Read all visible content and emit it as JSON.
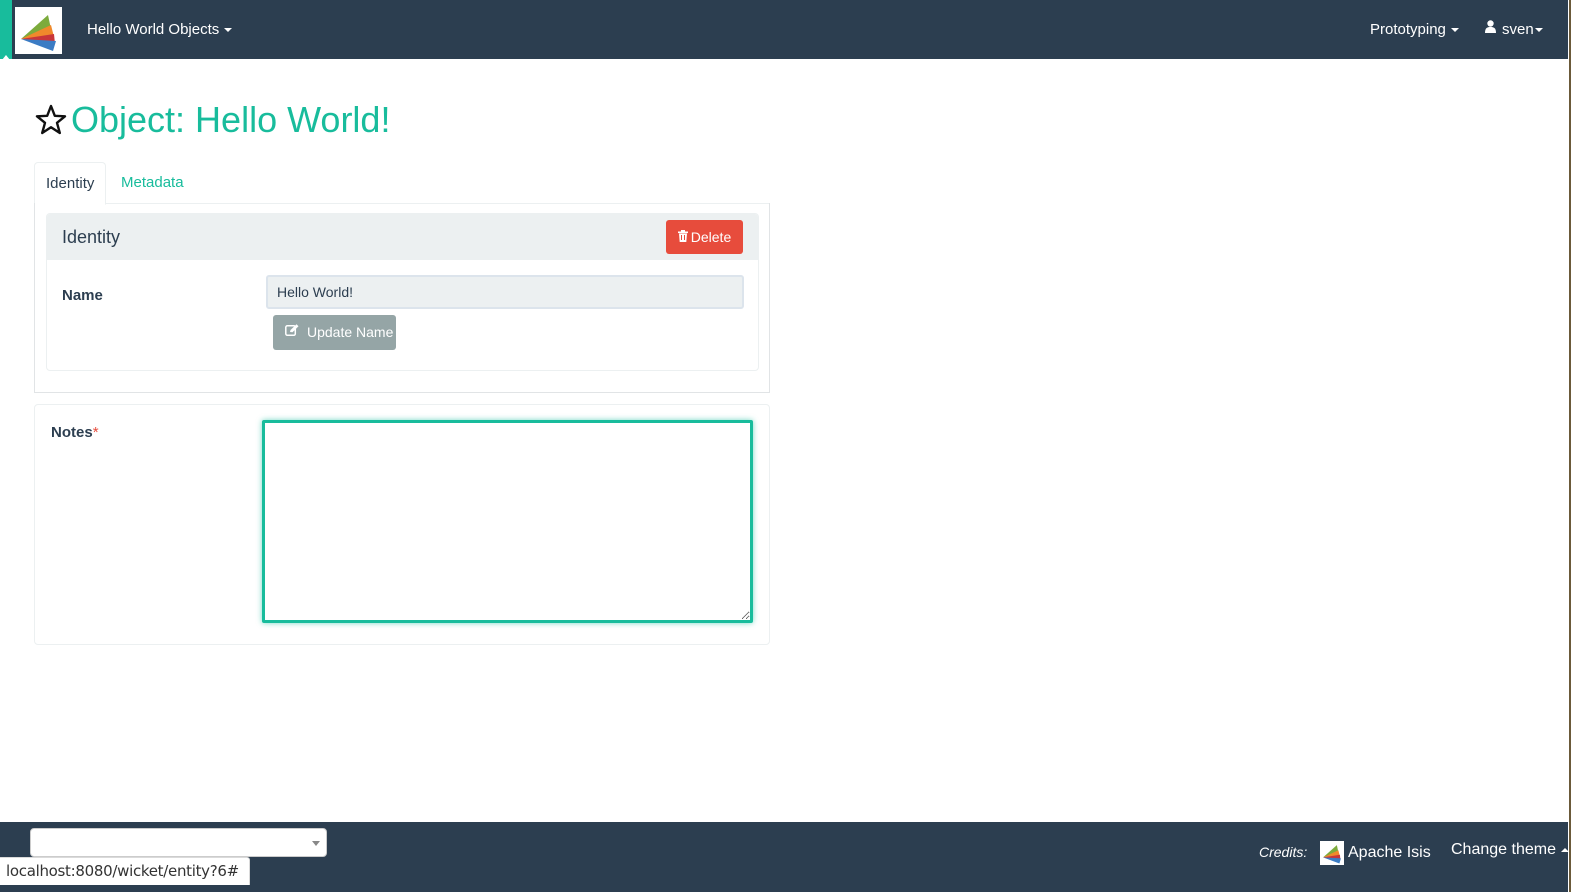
{
  "navbar": {
    "logo_icon": "apache-isis-logo",
    "app_menu_label": "Hello World Objects",
    "prototyping_label": "Prototyping",
    "user_icon": "user-icon",
    "user_label": "sven"
  },
  "page": {
    "favorite_icon": "star-outline-icon",
    "title": "Object: Hello World!"
  },
  "tabs": [
    {
      "label": "Identity",
      "active": true
    },
    {
      "label": "Metadata",
      "active": false
    }
  ],
  "identity_panel": {
    "heading": "Identity",
    "delete_icon": "trash-icon",
    "delete_label": "Delete",
    "name_label": "Name",
    "name_value": "Hello World!",
    "update_icon": "edit-icon",
    "update_label": "Update Name"
  },
  "notes_panel": {
    "label": "Notes",
    "required_marker": "*",
    "value": ""
  },
  "footer": {
    "select_value": "",
    "credits_label": "Credits:",
    "credit_link_label": "Apache Isis",
    "change_theme_label": "Change theme"
  },
  "status_bar": {
    "url": "localhost:8080/wicket/entity?6#"
  },
  "colors": {
    "navbar": "#2c3e50",
    "accent": "#18bc9c",
    "danger": "#e74c3c",
    "muted_button": "#95a5a6",
    "panel_heading": "#ecf0f1"
  }
}
